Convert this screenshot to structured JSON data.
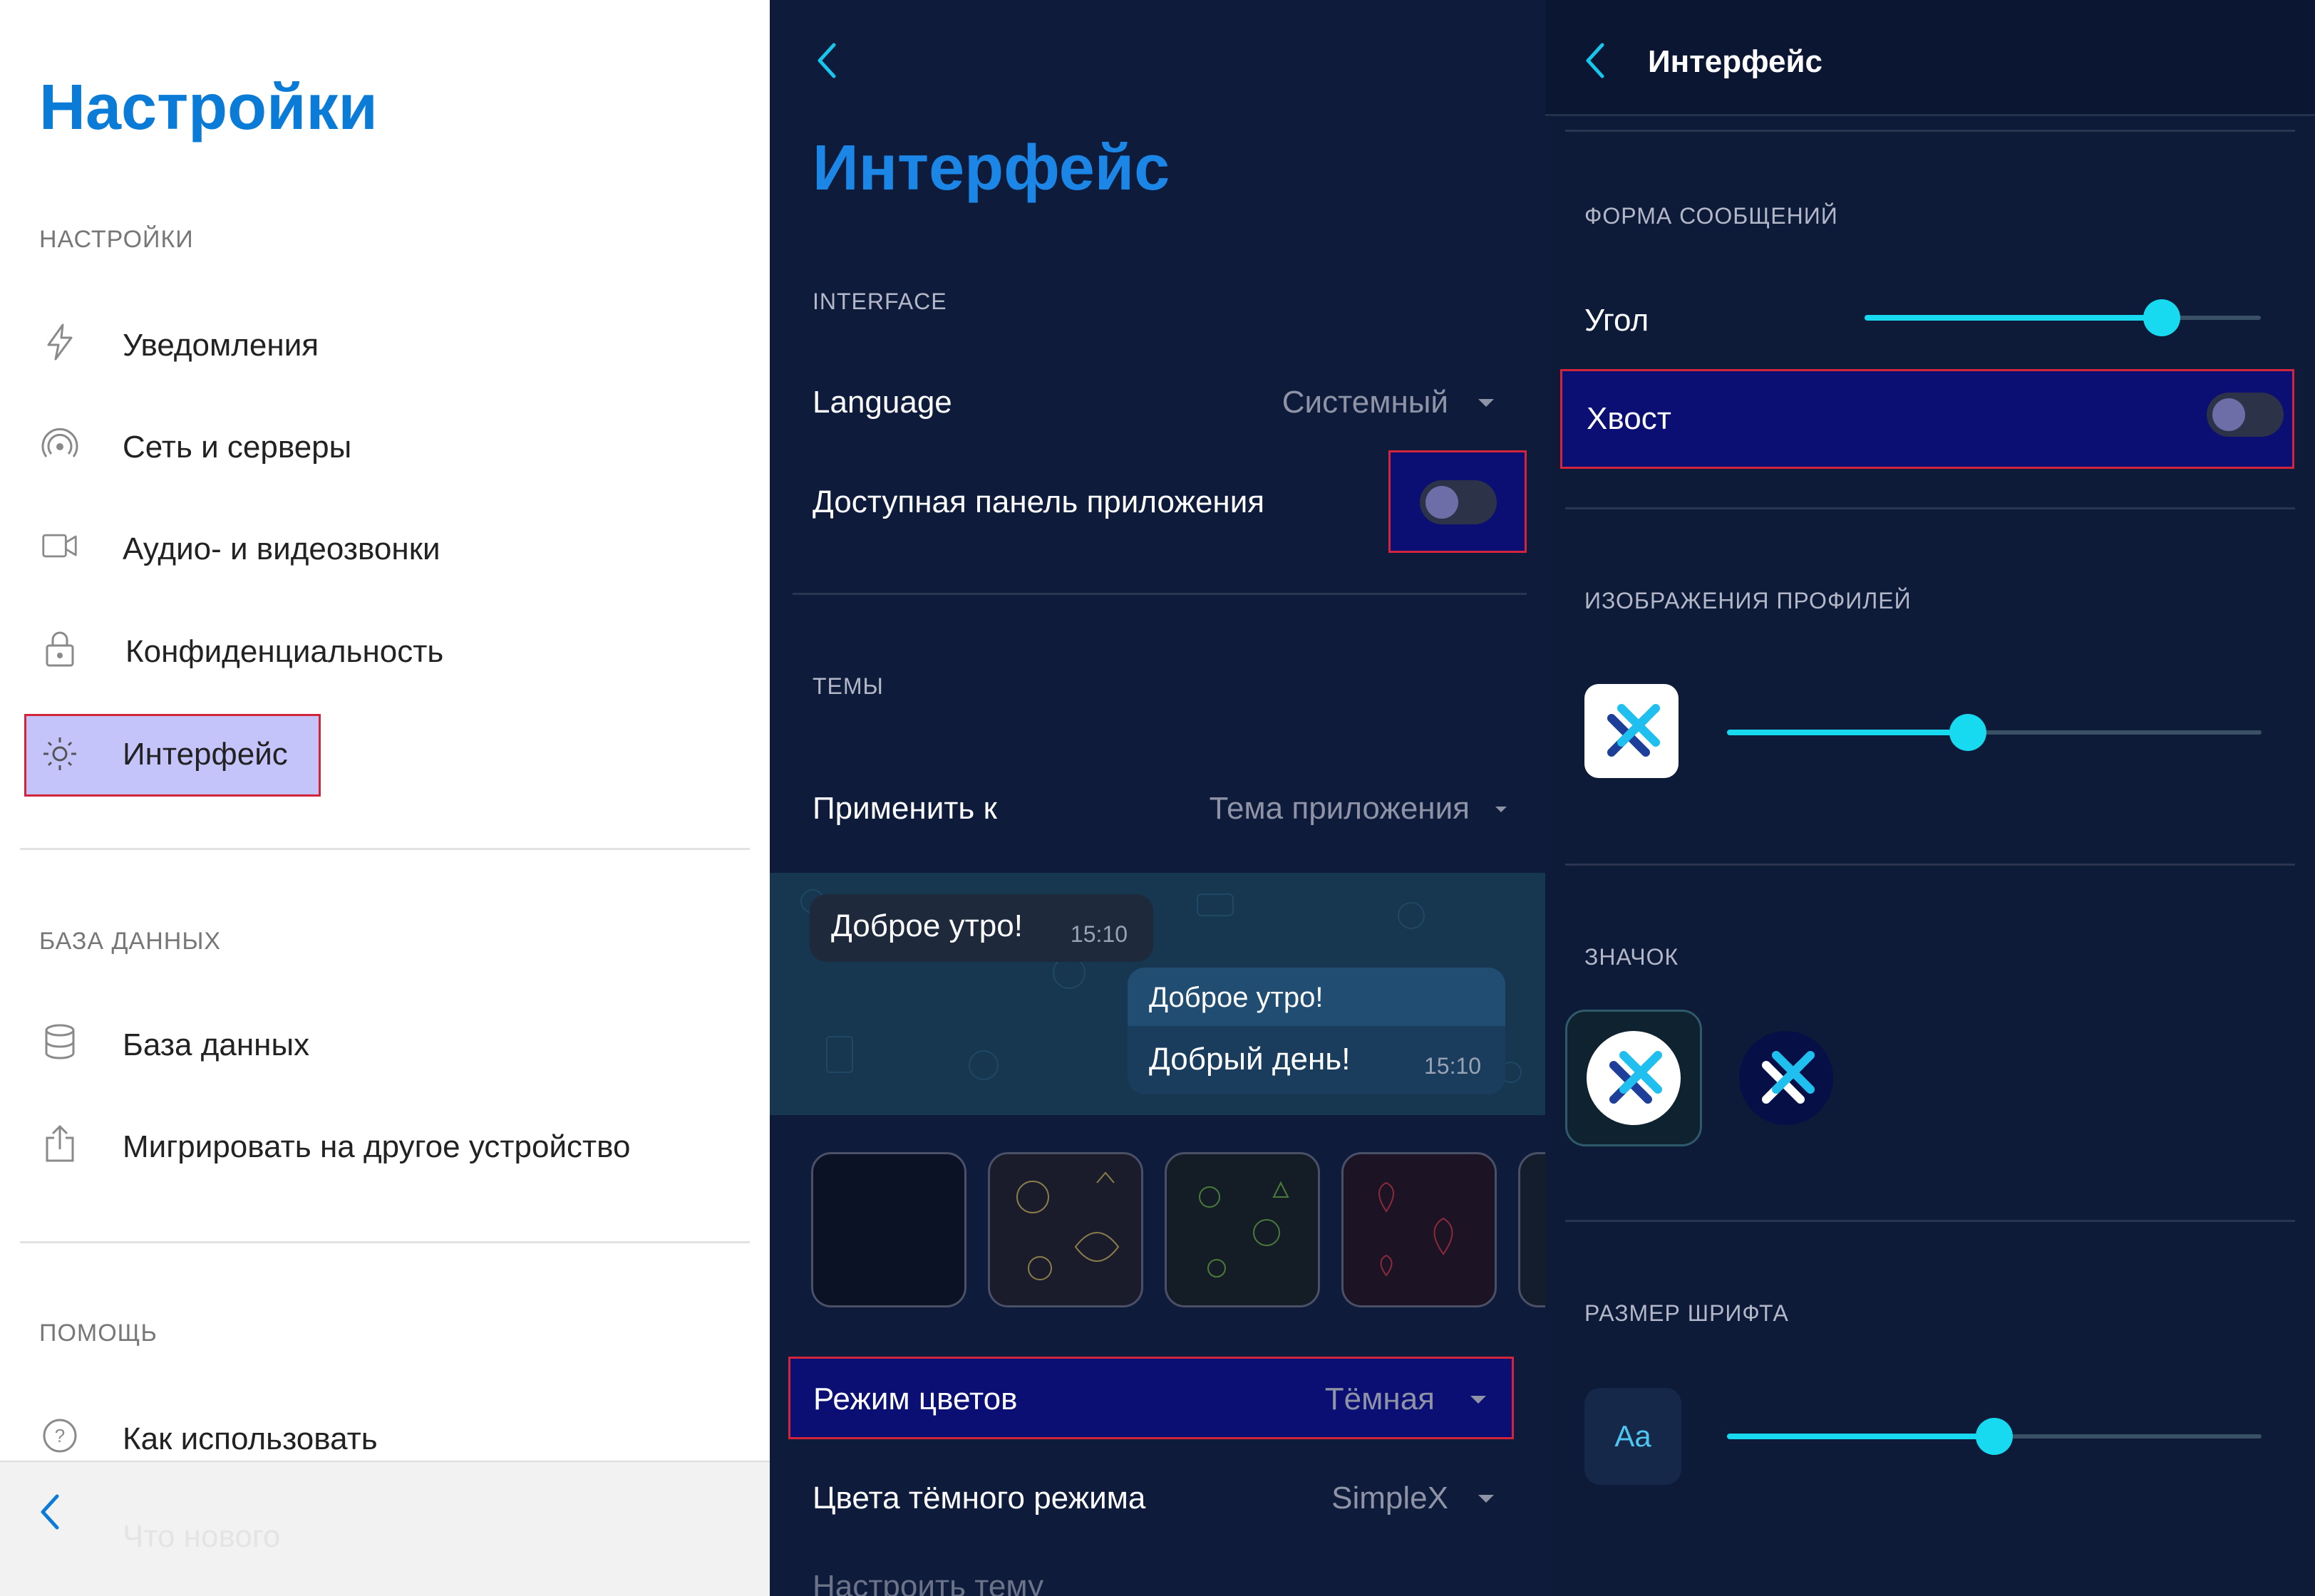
{
  "colors": {
    "accent_blue": "#0a7bd6",
    "cyan": "#17d9ef",
    "highlight_border": "#d2243a",
    "dark_bg": "#0e1b3a"
  },
  "settings_panel": {
    "title": "Настройки",
    "section_settings": "НАСТРОЙКИ",
    "items": [
      {
        "label": "Уведомления",
        "icon": "lightning-icon"
      },
      {
        "label": "Сеть и серверы",
        "icon": "network-icon"
      },
      {
        "label": "Аудио- и видеозвонки",
        "icon": "video-camera-icon"
      },
      {
        "label": "Конфиденциальность",
        "icon": "lock-icon"
      },
      {
        "label": "Интерфейс",
        "icon": "sun-icon",
        "selected": true
      }
    ],
    "section_database": "БАЗА ДАННЫХ",
    "db_items": [
      {
        "label": "База данных",
        "icon": "database-icon"
      },
      {
        "label": "Мигрировать на другое устройство",
        "icon": "share-icon"
      }
    ],
    "section_help": "ПОМОЩЬ",
    "help_items": [
      {
        "label": "Как использовать",
        "icon": "question-icon"
      },
      {
        "label": "Что нового",
        "icon": ""
      }
    ]
  },
  "interface_panel": {
    "title": "Интерфейс",
    "section_interface": "INTERFACE",
    "language_label": "Language",
    "language_value": "Системный",
    "app_bar_label": "Доступная панель приложения",
    "app_bar_toggle": false,
    "section_themes": "ТЕМЫ",
    "apply_to_label": "Применить к",
    "apply_to_value": "Тема приложения",
    "chat_preview": {
      "incoming_text": "Доброе утро!",
      "incoming_time": "15:10",
      "outgoing_quote": "Доброе утро!",
      "outgoing_text": "Добрый день!",
      "outgoing_time": "15:10"
    },
    "color_mode_label": "Режим цветов",
    "color_mode_value": "Тёмная",
    "dark_colors_label": "Цвета тёмного режима",
    "dark_colors_value": "SimpleX",
    "customize_label": "Настроить тему"
  },
  "interface_detail": {
    "header_title": "Интерфейс",
    "section_message_shape": "ФОРМА СООБЩЕНИЙ",
    "corner_label": "Угол",
    "corner_value": 0.75,
    "tail_label": "Хвост",
    "tail_toggle": false,
    "section_profile_images": "ИЗОБРАЖЕНИЯ ПРОФИЛЕЙ",
    "profile_corner_value": 0.45,
    "section_icon": "ЗНАЧОК",
    "section_font_size": "РАЗМЕР ШРИФТА",
    "font_sample": "Aa",
    "font_size_value": 0.5
  }
}
